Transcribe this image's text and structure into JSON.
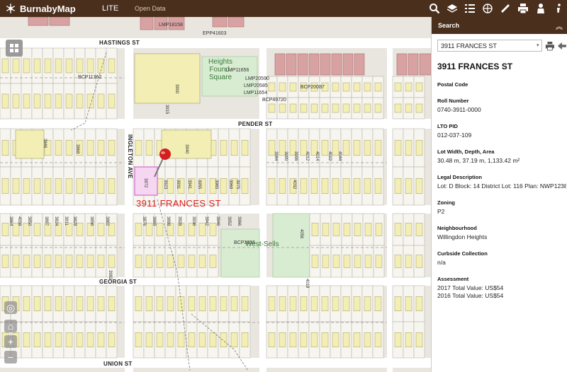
{
  "app": {
    "brand": "BurnabyMap",
    "nav_lite": "LITE",
    "nav_open_data": "Open Data"
  },
  "toolbar": {
    "icons": [
      "search-icon",
      "layers-icon",
      "legend-list-icon",
      "measure-tools-icon",
      "ruler-icon",
      "print-icon",
      "user-icon",
      "info-icon"
    ]
  },
  "map": {
    "streets": {
      "hastings": "HASTINGS ST",
      "pender": "PENDER ST",
      "georgia": "GEORGIA ST",
      "union": "UNION ST",
      "ingleton": "INGLETON AVE"
    },
    "parks": {
      "heights": "Heights\nFound.\nSquare",
      "west_sells": "West-Sells"
    },
    "selected_address_label": "3911 FRANCES ST",
    "parcel_numbers": [
      "3940",
      "3846",
      "3868",
      "3900",
      "3915",
      "3923",
      "3931",
      "3941",
      "3955",
      "3965",
      "3969",
      "3975",
      "3984",
      "3990",
      "3998",
      "4012",
      "4014",
      "4022",
      "4044",
      "4032",
      "4056",
      "4018",
      "4038",
      "3850",
      "3824",
      "3828",
      "3856",
      "3862",
      "3876",
      "3888",
      "3898",
      "3928",
      "3936",
      "3942",
      "3946",
      "3952",
      "3966",
      "3972",
      "3982",
      "3911",
      "3897",
      "3864",
      "3848",
      "3812"
    ],
    "map_codes": [
      "LMP18158",
      "EPP41603",
      "LMP11656",
      "LMP20590",
      "LMP20585",
      "LMP11654",
      "BCP20087",
      "BCP49720",
      "BCP11362",
      "BCP3655"
    ]
  },
  "panel": {
    "title": "Search",
    "search_value": "3911 FRANCES ST",
    "property_title": "3911 FRANCES ST",
    "fields": [
      {
        "label": "Postal Code",
        "value": ""
      },
      {
        "label": "Roll Number",
        "value": "0740-3911-0000"
      },
      {
        "label": "LTO PID",
        "value": "012-037-109"
      },
      {
        "label": "Lot Width, Depth, Area",
        "value": "30.48 m, 37.19 m, 1,133.42 m²"
      },
      {
        "label": "Legal Description",
        "value": "Lot: D Block: 14 District Lot: 116 Plan: NWP1238"
      },
      {
        "label": "Zoning",
        "value": "P2"
      },
      {
        "label": "Neighbourhood",
        "value": "Willingdon Heights"
      },
      {
        "label": "Curbside Collection",
        "value": "n/a"
      },
      {
        "label": "Assessment",
        "value": "2017 Total Value: US$54",
        "value2": "2016 Total Value: US$54"
      }
    ]
  },
  "colors": {
    "header_brown": "#4b2f1d",
    "parcel_fill": "#f7f5ef",
    "building_fill": "#f3efb4",
    "park_green": "#d8ecd2",
    "commercial_red": "#d9a2a2",
    "address_red": "#d22222"
  }
}
